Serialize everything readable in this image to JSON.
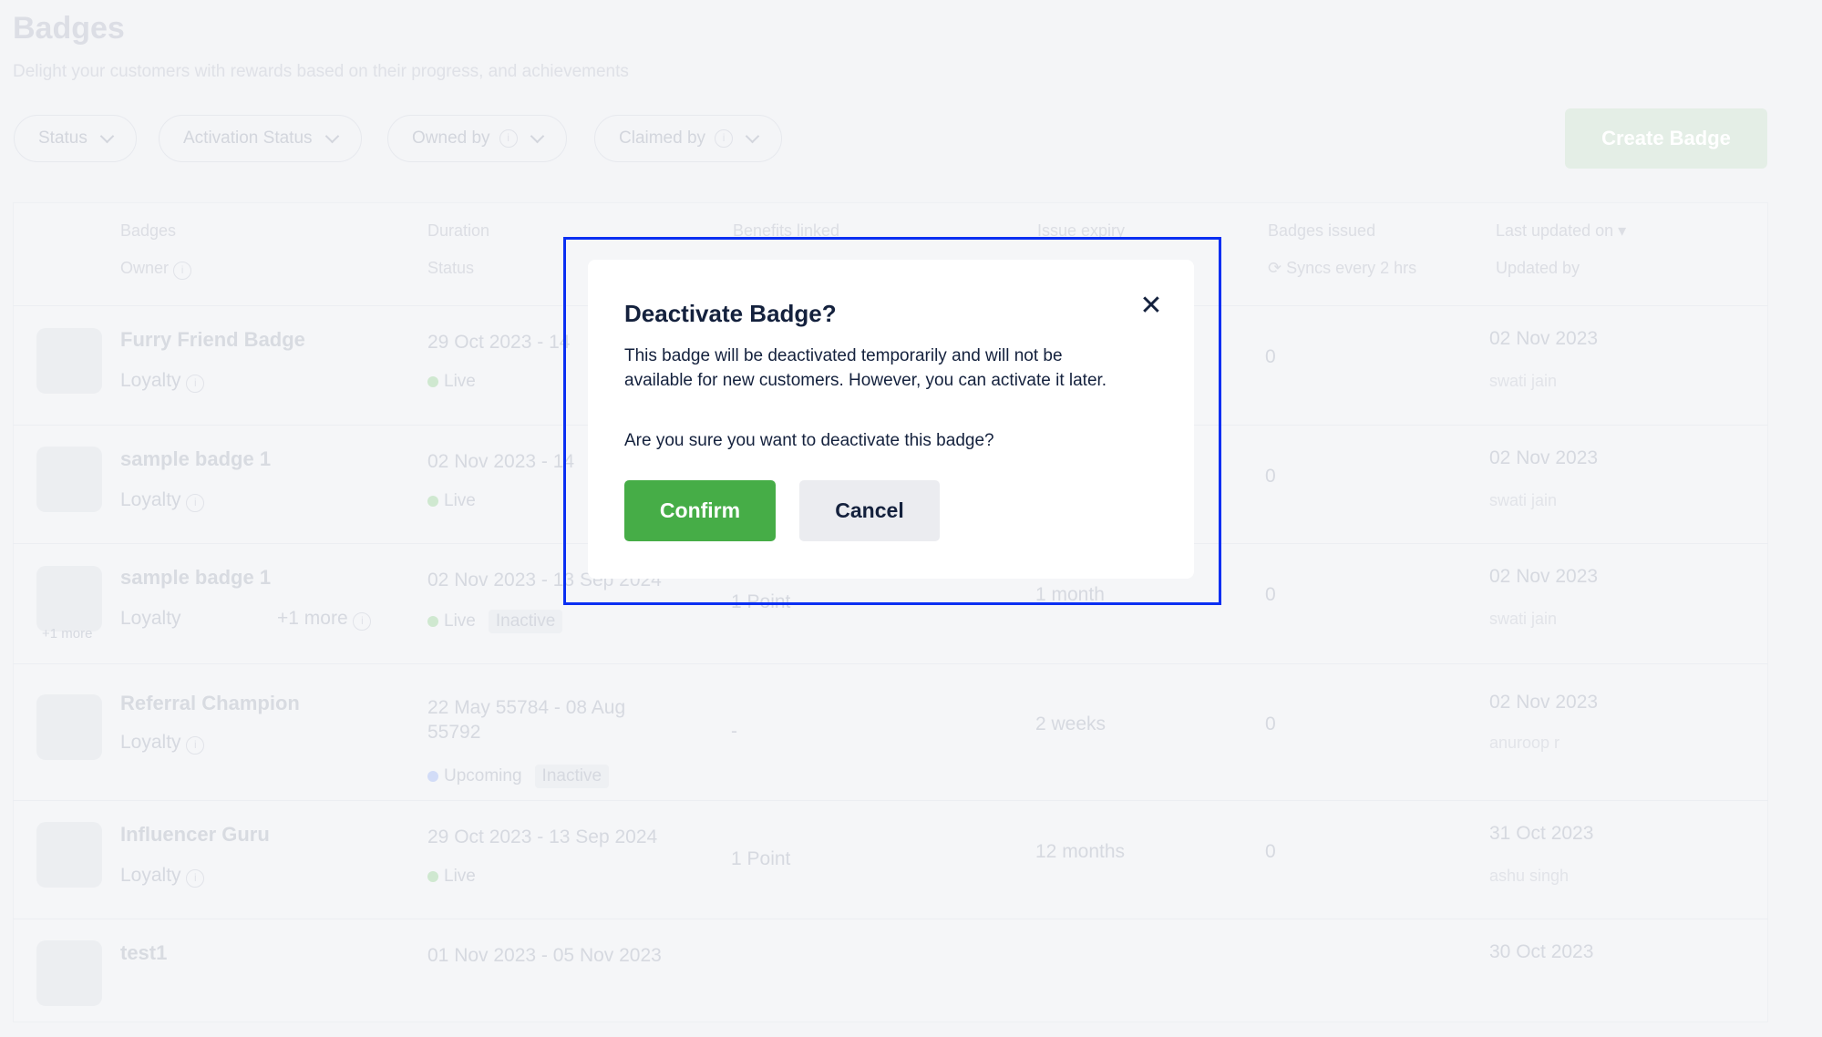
{
  "page": {
    "title": "Badges",
    "subtitle": "Delight your customers with rewards based on their progress, and achievements",
    "create_button": "Create Badge"
  },
  "filters": [
    {
      "label": "Status",
      "info": false
    },
    {
      "label": "Activation Status",
      "info": false
    },
    {
      "label": "Owned by",
      "info": true
    },
    {
      "label": "Claimed by",
      "info": true
    }
  ],
  "table": {
    "headers": {
      "badges": "Badges",
      "owner": "Owner",
      "duration": "Duration",
      "status": "Status",
      "benefits": "Benefits linked",
      "expiry": "Issue expiry",
      "issued": "Badges issued",
      "syncs": "Syncs every 2 hrs",
      "updated_on": "Last updated on",
      "updated_by": "Updated by"
    },
    "rows": [
      {
        "name": "Furry Friend Badge",
        "owner": "Loyalty",
        "more": "",
        "thumb_more": "",
        "duration": "29 Oct 2023 - 14",
        "status": "Live",
        "status_color": "#cfe8d0",
        "activation": "",
        "benefits": "",
        "expiry": "",
        "issued": "0",
        "updated_on": "02 Nov 2023",
        "updated_by": "swati jain"
      },
      {
        "name": "sample badge 1",
        "owner": "Loyalty",
        "more": "",
        "thumb_more": "",
        "duration": "02 Nov 2023 - 14",
        "status": "Live",
        "status_color": "#cfe8d0",
        "activation": "",
        "benefits": "",
        "expiry": "",
        "issued": "0",
        "updated_on": "02 Nov 2023",
        "updated_by": "swati jain"
      },
      {
        "name": "sample badge 1",
        "owner": "Loyalty",
        "more": "+1 more",
        "thumb_more": "+1 more",
        "duration": "02 Nov 2023 - 13 Sep 2024",
        "status": "Live",
        "status_color": "#cfe8d0",
        "activation": "Inactive",
        "benefits": "1 Point",
        "expiry": "1 month",
        "issued": "0",
        "updated_on": "02 Nov 2023",
        "updated_by": "swati jain"
      },
      {
        "name": "Referral Champion",
        "owner": "Loyalty",
        "more": "",
        "thumb_more": "",
        "duration": "22 May 55784 - 08 Aug 55792",
        "status": "Upcoming",
        "status_color": "#d2dcf7",
        "activation": "Inactive",
        "benefits": "-",
        "expiry": "2 weeks",
        "issued": "0",
        "updated_on": "02 Nov 2023",
        "updated_by": "anuroop r"
      },
      {
        "name": "Influencer Guru",
        "owner": "Loyalty",
        "more": "",
        "thumb_more": "",
        "duration": "29 Oct 2023 - 13 Sep 2024",
        "status": "Live",
        "status_color": "#cfe8d0",
        "activation": "",
        "benefits": "1 Point",
        "expiry": "12 months",
        "issued": "0",
        "updated_on": "31 Oct 2023",
        "updated_by": "ashu singh"
      },
      {
        "name": "test1",
        "owner": "",
        "more": "",
        "thumb_more": "",
        "duration": "01 Nov 2023 - 05 Nov 2023",
        "status": "",
        "status_color": "#cfe8d0",
        "activation": "",
        "benefits": "",
        "expiry": "",
        "issued": "",
        "updated_on": "30 Oct 2023",
        "updated_by": ""
      }
    ]
  },
  "modal": {
    "title": "Deactivate Badge?",
    "body": "This badge will be deactivated temporarily and will not be available for new customers. However, you can activate it later.",
    "question": "Are you sure you want to deactivate this badge?",
    "confirm": "Confirm",
    "cancel": "Cancel",
    "close_icon": "close-icon"
  },
  "colors": {
    "confirm": "#46ad47",
    "highlight": "#0a2ff2",
    "text": "#14213d"
  }
}
